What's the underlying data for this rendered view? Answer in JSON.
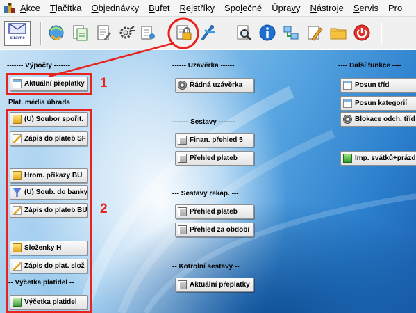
{
  "menubar": {
    "items": [
      {
        "lead": "",
        "ul": "A",
        "rest": "kce"
      },
      {
        "lead": "",
        "ul": "T",
        "rest": "lačítka"
      },
      {
        "lead": "",
        "ul": "O",
        "rest": "bjednávky"
      },
      {
        "lead": "",
        "ul": "B",
        "rest": "ufet"
      },
      {
        "lead": "",
        "ul": "R",
        "rest": "ejstříky"
      },
      {
        "lead": "Spo",
        "ul": "l",
        "rest": "ečné"
      },
      {
        "lead": "Úpra",
        "ul": "v",
        "rest": "y"
      },
      {
        "lead": "",
        "ul": "N",
        "rest": "ástroje"
      },
      {
        "lead": "",
        "ul": "S",
        "rest": "ervis"
      },
      {
        "lead": "Pro",
        "ul": "",
        "rest": ""
      }
    ]
  },
  "toolbar": {
    "first_label": "stravné"
  },
  "columns": {
    "col1": {
      "header": "------- Výpočty -------",
      "btn_aktualni": "Aktuální přeplatky",
      "label_plat": "Plat. média úhrada",
      "btn_soubor": "(U) Soubor spořit.",
      "btn_zapis_sf": "Zápis do plateb SF",
      "btn_hrom": "Hrom. příkazy BU",
      "btn_soub_banky": "(U) Soub. do banky",
      "btn_zapis_bu": "Zápis do plateb BU",
      "btn_slozenky": "Složenky H",
      "btn_zapis_sloz": "Zápis do plat. slož",
      "label_vycetka": "-- Výčetka platidel --",
      "btn_vycetka": "Výčetka platidel"
    },
    "col2": {
      "header_uzaverka": "------ Uzávěrka ------",
      "btn_radna": "Řádná uzávěrka",
      "header_sestavy": "------- Sestavy -------",
      "btn_finan": "Finan. přehled 5",
      "btn_prehled_plateb": "Přehled plateb",
      "header_rekap": "--- Sestavy rekap. ---",
      "btn_prehled_plateb2": "Přehled plateb",
      "btn_prehled_obdobi": "Přehled za období",
      "header_kontrolni": "-- Kotrolní sestavy --",
      "btn_aktualni2": "Aktuální přeplatky"
    },
    "col3": {
      "header": "---- Další funkce ----",
      "btn_posun_trid": "Posun tříd",
      "btn_posun_kat": "Posun kategorií",
      "btn_blokace": "Blokace odch. tříd",
      "btn_imp": "Imp. svátků+prázd"
    }
  },
  "annotations": {
    "num1": "1",
    "num2": "2",
    "color": "#e8221c"
  }
}
